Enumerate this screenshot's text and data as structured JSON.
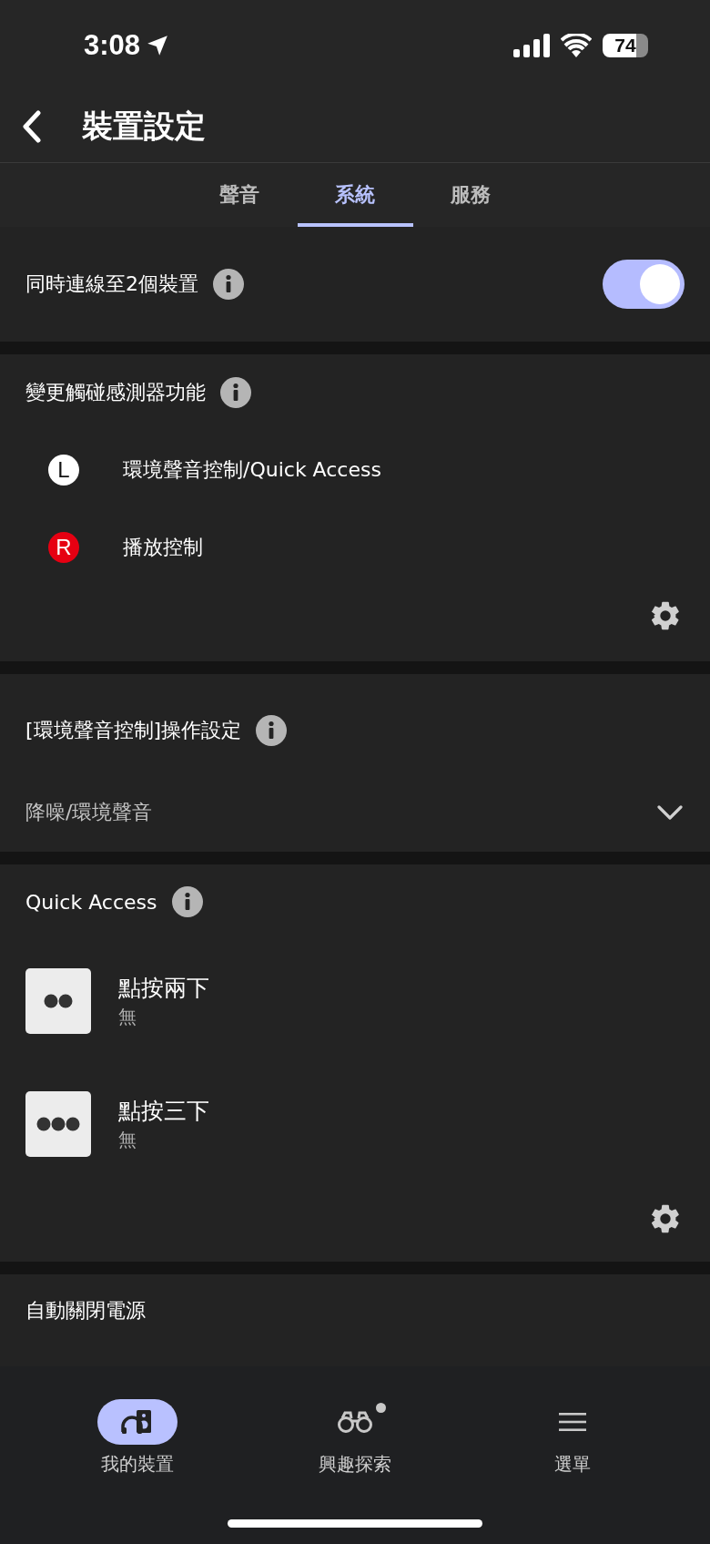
{
  "status_bar": {
    "time": "3:08",
    "battery": "74"
  },
  "header": {
    "title": "裝置設定"
  },
  "tabs": [
    {
      "label": "聲音",
      "selected": false
    },
    {
      "label": "系統",
      "selected": true
    },
    {
      "label": "服務",
      "selected": false
    }
  ],
  "sections": [
    {
      "kind": "toggle",
      "title": "同時連線至2個裝置",
      "info": true,
      "on": true
    },
    {
      "kind": "sides",
      "title": "變更觸碰感測器功能",
      "info": true,
      "items": [
        {
          "side": "L",
          "label": "環境聲音控制/Quick Access",
          "color": "#ffffff"
        },
        {
          "side": "R",
          "label": "播放控制",
          "color": "#e60012"
        }
      ]
    },
    {
      "kind": "dropdown",
      "title": "[環境聲音控制]操作設定",
      "info": true,
      "value": "降噪/環境聲音"
    },
    {
      "kind": "taps",
      "title": "Quick Access",
      "info": true,
      "items": [
        {
          "kind": "double",
          "label": "點按兩下",
          "value": "無"
        },
        {
          "kind": "triple",
          "label": "點按三下",
          "value": "無"
        }
      ]
    },
    {
      "kind": "plain",
      "title": "自動關閉電源",
      "info": false
    }
  ],
  "nav": [
    {
      "kind": "device",
      "label": "我的裝置",
      "selected": true,
      "new": false
    },
    {
      "kind": "explore",
      "label": "興趣探索",
      "selected": false,
      "new": true
    },
    {
      "kind": "menu",
      "label": "選單",
      "selected": false,
      "new": false
    }
  ]
}
